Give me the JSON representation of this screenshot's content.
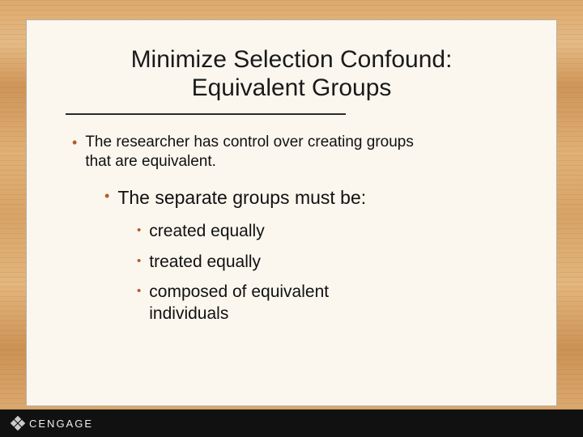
{
  "slide": {
    "title_line1": "Minimize Selection Confound:",
    "title_line2": "Equivalent Groups",
    "bullets": {
      "lvl1": "The researcher has control over creating groups that are equivalent.",
      "lvl2": "The separate groups must be:",
      "lvl3a": "created equally",
      "lvl3b": "treated equally",
      "lvl3c": "composed of equivalent individuals"
    }
  },
  "footer": {
    "brand": "CENGAGE"
  }
}
